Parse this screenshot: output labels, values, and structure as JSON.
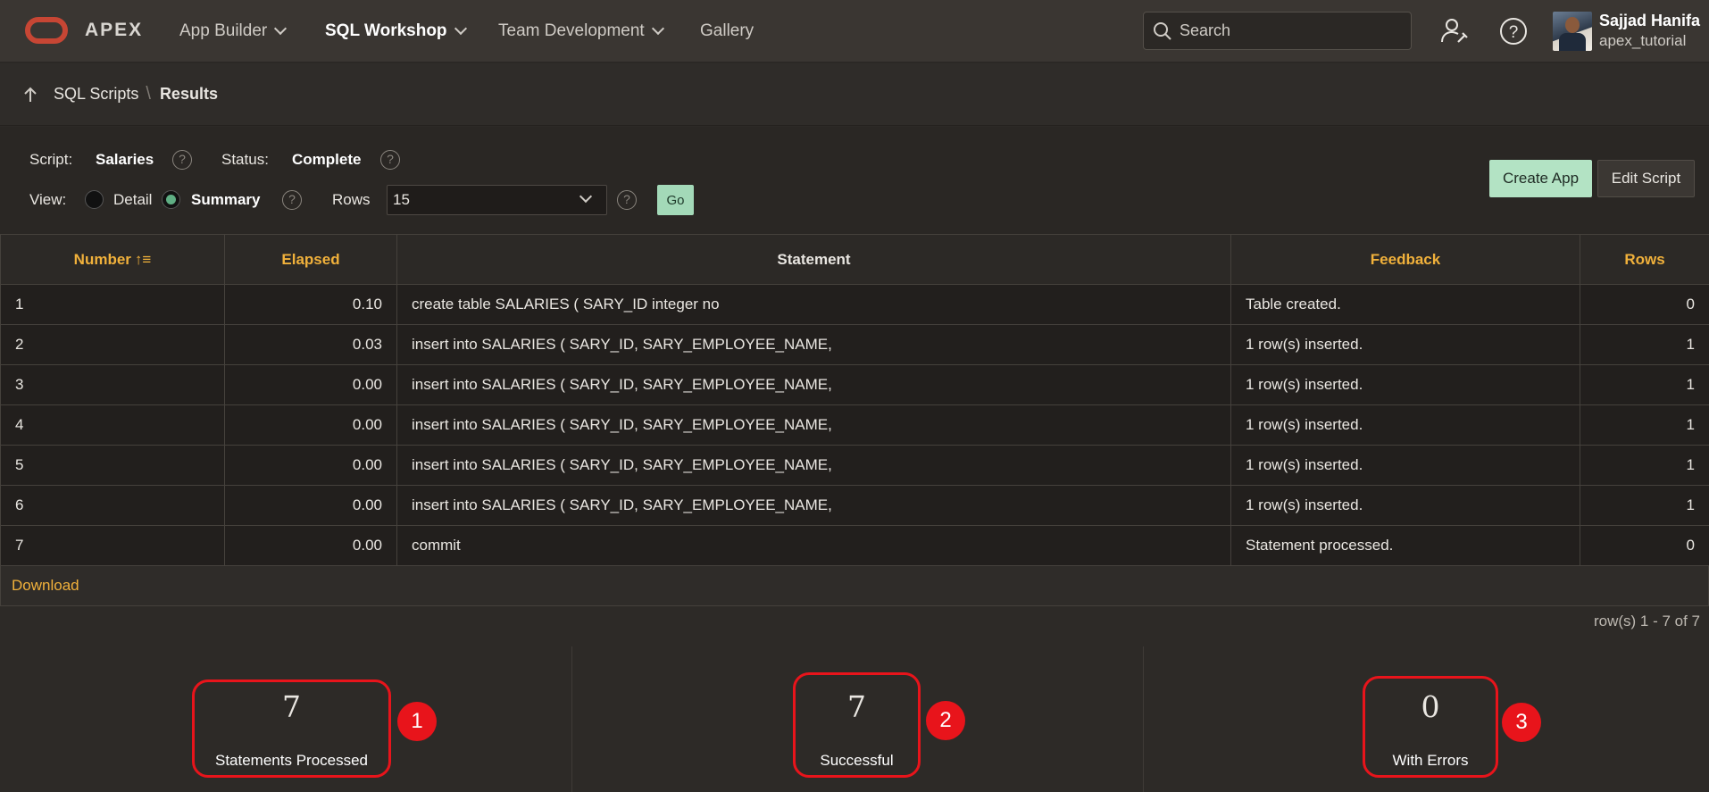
{
  "app": {
    "logo_text": "APEX"
  },
  "nav": {
    "items": [
      {
        "label": "App Builder"
      },
      {
        "label": "SQL Workshop"
      },
      {
        "label": "Team Development"
      },
      {
        "label": "Gallery"
      }
    ]
  },
  "search": {
    "placeholder": "Search"
  },
  "user": {
    "name": "Sajjad Hanifa",
    "workspace": "apex_tutorial"
  },
  "breadcrumb": {
    "parent": "SQL Scripts",
    "separator": "\\",
    "current": "Results"
  },
  "script_info": {
    "script_label": "Script:",
    "script_value": "Salaries",
    "status_label": "Status:",
    "status_value": "Complete",
    "view_label": "View:",
    "view_options": [
      "Detail",
      "Summary"
    ],
    "view_selected": "Summary",
    "rows_label": "Rows",
    "rows_value": "15",
    "go_label": "Go",
    "help_glyph": "?"
  },
  "actions": {
    "create_app": "Create App",
    "edit_script": "Edit Script"
  },
  "table": {
    "columns": [
      "Number",
      "Elapsed",
      "Statement",
      "Feedback",
      "Rows"
    ],
    "sort_indicator": "↑≡",
    "rows": [
      {
        "number": "1",
        "elapsed": "0.10",
        "statement": "create table SALARIES ( SARY_ID integer no",
        "feedback": "Table created.",
        "rows": "0"
      },
      {
        "number": "2",
        "elapsed": "0.03",
        "statement": "insert into SALARIES ( SARY_ID, SARY_EMPLOYEE_NAME,",
        "feedback": "1 row(s) inserted.",
        "rows": "1"
      },
      {
        "number": "3",
        "elapsed": "0.00",
        "statement": "insert into SALARIES ( SARY_ID, SARY_EMPLOYEE_NAME,",
        "feedback": "1 row(s) inserted.",
        "rows": "1"
      },
      {
        "number": "4",
        "elapsed": "0.00",
        "statement": "insert into SALARIES ( SARY_ID, SARY_EMPLOYEE_NAME,",
        "feedback": "1 row(s) inserted.",
        "rows": "1"
      },
      {
        "number": "5",
        "elapsed": "0.00",
        "statement": "insert into SALARIES ( SARY_ID, SARY_EMPLOYEE_NAME,",
        "feedback": "1 row(s) inserted.",
        "rows": "1"
      },
      {
        "number": "6",
        "elapsed": "0.00",
        "statement": "insert into SALARIES ( SARY_ID, SARY_EMPLOYEE_NAME,",
        "feedback": "1 row(s) inserted.",
        "rows": "1"
      },
      {
        "number": "7",
        "elapsed": "0.00",
        "statement": "commit",
        "feedback": "Statement processed.",
        "rows": "0"
      }
    ],
    "download_label": "Download",
    "pagination": "row(s) 1 - 7 of 7"
  },
  "summary": [
    {
      "value": "7",
      "label": "Statements Processed",
      "marker": "1"
    },
    {
      "value": "7",
      "label": "Successful",
      "marker": "2"
    },
    {
      "value": "0",
      "label": "With Errors",
      "marker": "3"
    }
  ],
  "colors": {
    "accent_gold": "#f1b13b",
    "highlight_red": "#e8141b",
    "button_green": "#b3e3c4",
    "oracle_red": "#c74634"
  }
}
